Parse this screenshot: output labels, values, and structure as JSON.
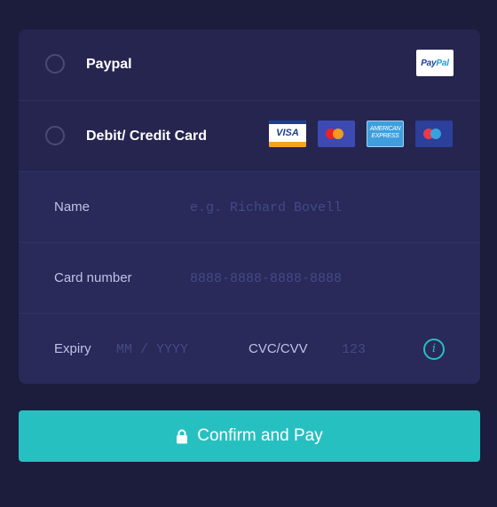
{
  "payment_options": {
    "paypal": {
      "label": "Paypal",
      "badge_text_1": "Pay",
      "badge_text_2": "Pal"
    },
    "card": {
      "label": "Debit/ Credit Card",
      "brands": {
        "visa": "VISA",
        "amex": "AMERICAN EXPRESS"
      }
    }
  },
  "form": {
    "name": {
      "label": "Name",
      "placeholder": "e.g. Richard Bovell",
      "value": ""
    },
    "card_number": {
      "label": "Card number",
      "placeholder": "8888-8888-8888-8888",
      "value": ""
    },
    "expiry": {
      "label": "Expiry",
      "placeholder": "MM / YYYY",
      "value": ""
    },
    "cvc": {
      "label": "CVC/CVV",
      "placeholder": "123",
      "value": ""
    },
    "info_icon_glyph": "i"
  },
  "submit": {
    "label": "Confirm and Pay"
  },
  "colors": {
    "page_background": "#1c1c3d",
    "card_background": "#252550",
    "form_background": "#29295a",
    "accent": "#27c0c0",
    "label": "#c2c2e6",
    "placeholder": "#444a86"
  },
  "icons": {
    "lock": "lock-icon",
    "info": "info-icon",
    "radio": "radio-unchecked"
  }
}
